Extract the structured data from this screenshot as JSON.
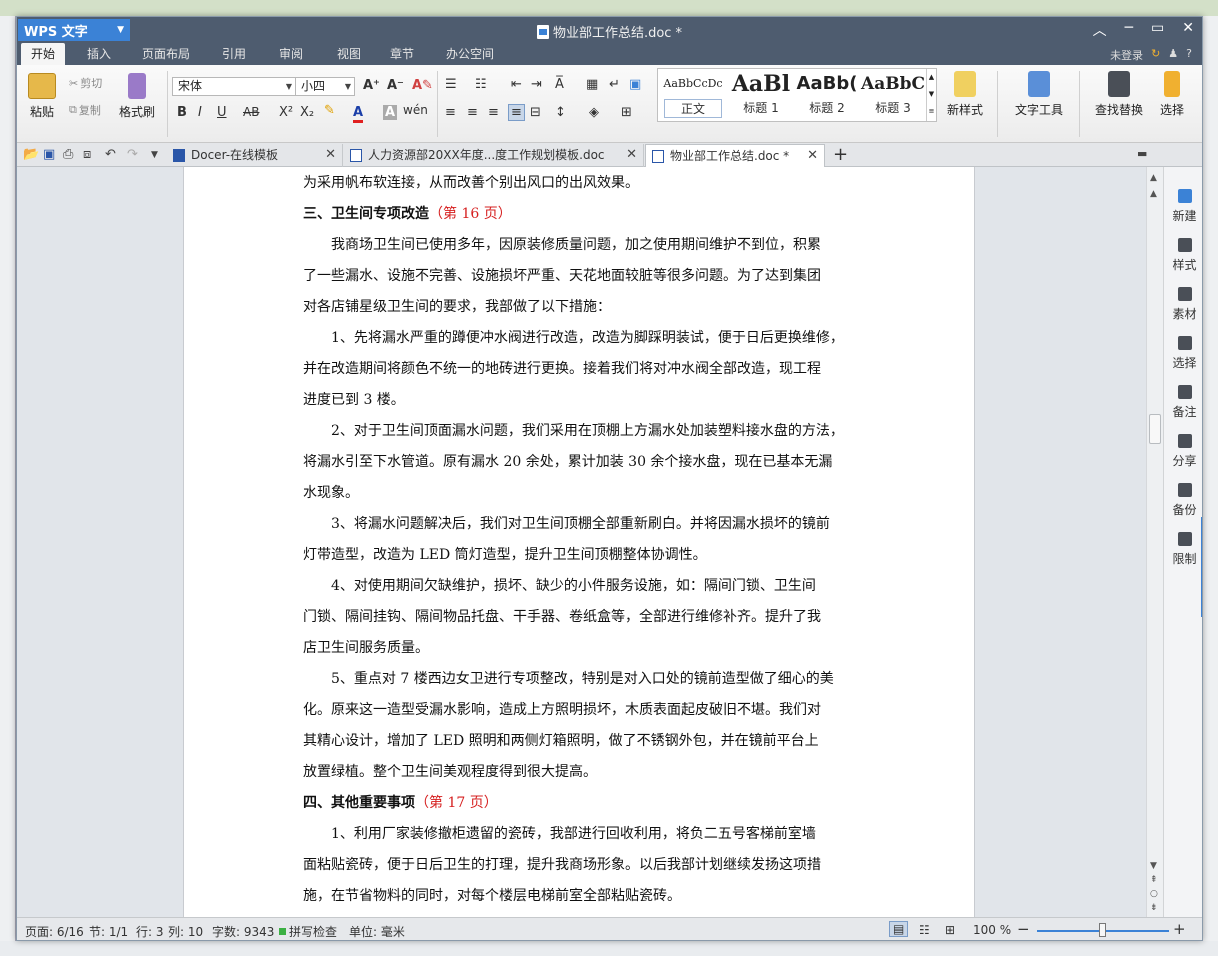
{
  "window": {
    "app_name": "WPS 文字",
    "doc_title": "物业部工作总结.doc *"
  },
  "menu": {
    "tabs": [
      "开始",
      "插入",
      "页面布局",
      "引用",
      "审阅",
      "视图",
      "章节",
      "办公空间"
    ],
    "active_tab": "开始",
    "login": "未登录",
    "help": "?"
  },
  "ribbon": {
    "paste": "粘贴",
    "cut": "剪切",
    "copy": "复制",
    "format_painter": "格式刷",
    "font_name": "宋体",
    "font_size": "小四",
    "styles": [
      {
        "sample": "AaBbCcDc",
        "label": "正文"
      },
      {
        "sample": "AaBl",
        "label": "标题 1"
      },
      {
        "sample": "AaBb(",
        "label": "标题 2"
      },
      {
        "sample": "AaBbC",
        "label": "标题 3"
      }
    ],
    "new_style": "新样式",
    "text_tools": "文字工具",
    "find_replace": "查找替换",
    "select": "选择"
  },
  "doc_tabs": [
    {
      "label": "Docer-在线模板",
      "active": false
    },
    {
      "label": "人力资源部20XX年度...度工作规划模板.doc",
      "active": false
    },
    {
      "label": "物业部工作总结.doc *",
      "active": true
    }
  ],
  "document": {
    "lines": [
      {
        "text": "为采用帆布软连接，从而改善个别出风口的出风效果。",
        "indent": false,
        "heading": false
      },
      {
        "text": "三、卫生间专项改造",
        "ref": "（第 16 页）",
        "indent": false,
        "heading": true
      },
      {
        "text": "我商场卫生间已使用多年，因原装修质量问题，加之使用期间维护不到位，积累",
        "indent": true,
        "heading": false
      },
      {
        "text": "了一些漏水、设施不完善、设施损坏严重、天花地面较脏等很多问题。为了达到集团",
        "indent": false,
        "heading": false
      },
      {
        "text": "对各店铺星级卫生间的要求，我部做了以下措施：",
        "indent": false,
        "heading": false
      },
      {
        "text": "1、先将漏水严重的蹲便冲水阀进行改造，改造为脚踩明装试，便于日后更换维修，",
        "indent": true,
        "heading": false
      },
      {
        "text": "并在改造期间将颜色不统一的地砖进行更换。接着我们将对冲水阀全部改造，现工程",
        "indent": false,
        "heading": false
      },
      {
        "text": "进度已到 3 楼。",
        "indent": false,
        "heading": false
      },
      {
        "text": "2、对于卫生间顶面漏水问题，我们采用在顶棚上方漏水处加装塑料接水盘的方法，",
        "indent": true,
        "heading": false
      },
      {
        "text": "将漏水引至下水管道。原有漏水 20 余处，累计加装 30 余个接水盘，现在已基本无漏",
        "indent": false,
        "heading": false
      },
      {
        "text": "水现象。",
        "indent": false,
        "heading": false
      },
      {
        "text": "3、将漏水问题解决后，我们对卫生间顶棚全部重新刷白。并将因漏水损坏的镜前",
        "indent": true,
        "heading": false
      },
      {
        "text": "灯带造型，改造为 LED 筒灯造型，提升卫生间顶棚整体协调性。",
        "indent": false,
        "heading": false
      },
      {
        "text": "4、对使用期间欠缺维护，损坏、缺少的小件服务设施，如：隔间门锁、卫生间",
        "indent": true,
        "heading": false
      },
      {
        "text": "门锁、隔间挂钩、隔间物品托盘、干手器、卷纸盒等，全部进行维修补齐。提升了我",
        "indent": false,
        "heading": false
      },
      {
        "text": "店卫生间服务质量。",
        "indent": false,
        "heading": false
      },
      {
        "text": "5、重点对 7 楼西边女卫进行专项整改，特别是对入口处的镜前造型做了细心的美",
        "indent": true,
        "heading": false
      },
      {
        "text": "化。原来这一造型受漏水影响，造成上方照明损坏，木质表面起皮破旧不堪。我们对",
        "indent": false,
        "heading": false
      },
      {
        "text": "其精心设计，增加了 LED 照明和两侧灯箱照明，做了不锈钢外包，并在镜前平台上",
        "indent": false,
        "heading": false
      },
      {
        "text": "放置绿植。整个卫生间美观程度得到很大提高。",
        "indent": false,
        "heading": false
      },
      {
        "text": "四、其他重要事项",
        "ref": "（第 17 页）",
        "indent": false,
        "heading": true
      },
      {
        "text": "1、利用厂家装修撤柜遗留的瓷砖，我部进行回收利用，将负二五号客梯前室墙",
        "indent": true,
        "heading": false
      },
      {
        "text": "面粘贴瓷砖，便于日后卫生的打理，提升我商场形象。以后我部计划继续发扬这项措",
        "indent": false,
        "heading": false
      },
      {
        "text": "施，在节省物料的同时，对每个楼层电梯前室全部粘贴瓷砖。",
        "indent": false,
        "heading": false
      }
    ]
  },
  "side_panel": [
    "新建",
    "样式",
    "素材",
    "选择",
    "备注",
    "分享",
    "备份",
    "限制"
  ],
  "status": {
    "page": "页面: 6/16",
    "section": "节: 1/1",
    "row": "行: 3",
    "col": "列: 10",
    "words": "字数: 9343",
    "spell": "拼写检查",
    "unit": "单位: 毫米",
    "zoom": "100 %",
    "zoom_level": 0.5
  },
  "colors": {
    "accent": "#3b82d6",
    "titlebar": "#4e5c6f",
    "heading_ref": "#d62020"
  }
}
